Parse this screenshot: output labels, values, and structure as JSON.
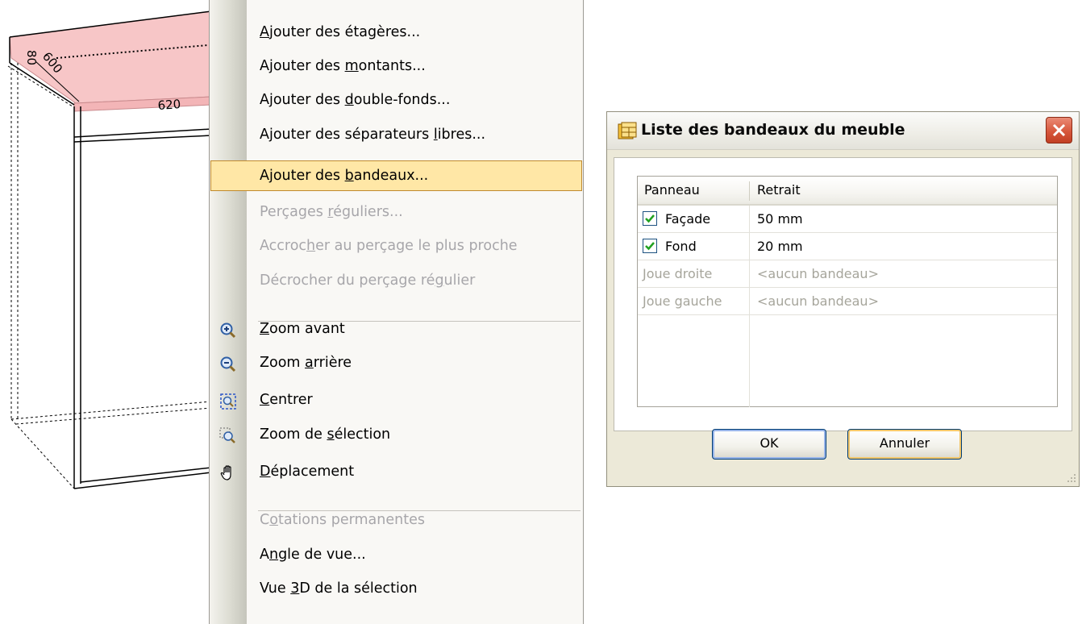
{
  "cabinet": {
    "dim_height": "80",
    "dim_depth": "600",
    "dim_width": "620",
    "highlight_color": "#f7c6c7"
  },
  "context_menu": {
    "items": [
      {
        "label": "Ajouter des étagères...",
        "pre": "",
        "u": "A",
        "post": "jouter des étagères...",
        "disabled": false,
        "highlighted": false,
        "icon": ""
      },
      {
        "label": "Ajouter des montants...",
        "pre": "Ajouter des ",
        "u": "m",
        "post": "ontants...",
        "disabled": false,
        "highlighted": false,
        "icon": ""
      },
      {
        "label": "Ajouter des double-fonds...",
        "pre": "Ajouter des ",
        "u": "d",
        "post": "ouble-fonds...",
        "disabled": false,
        "highlighted": false,
        "icon": ""
      },
      {
        "label": "Ajouter des séparateurs libres...",
        "pre": "Ajouter des séparateurs ",
        "u": "l",
        "post": "ibres...",
        "disabled": false,
        "highlighted": false,
        "icon": ""
      },
      {
        "label": "Ajouter des bandeaux...",
        "pre": "Ajouter des ",
        "u": "b",
        "post": "andeaux...",
        "disabled": false,
        "highlighted": true,
        "icon": ""
      },
      {
        "label": "Perçages réguliers...",
        "pre": "Perçages ",
        "u": "r",
        "post": "éguliers...",
        "disabled": true,
        "highlighted": false,
        "icon": ""
      },
      {
        "label": "Accrocher au perçage le plus proche",
        "pre": "Accroc",
        "u": "h",
        "post": "er au perçage le plus proche",
        "disabled": true,
        "highlighted": false,
        "icon": ""
      },
      {
        "label": "Décrocher du perçage régulier",
        "pre": "Décrocher du perçage ré",
        "u": "g",
        "post": "ulier",
        "disabled": true,
        "highlighted": false,
        "icon": ""
      },
      {
        "label": "Zoom avant",
        "pre": "",
        "u": "Z",
        "post": "oom avant",
        "disabled": false,
        "highlighted": false,
        "icon": "zoom-in-icon"
      },
      {
        "label": "Zoom arrière",
        "pre": "Zoom ",
        "u": "a",
        "post": "rrière",
        "disabled": false,
        "highlighted": false,
        "icon": "zoom-out-icon"
      },
      {
        "label": "Centrer",
        "pre": "",
        "u": "C",
        "post": "entrer",
        "disabled": false,
        "highlighted": false,
        "icon": "center-view-icon"
      },
      {
        "label": "Zoom de sélection",
        "pre": "Zoom de ",
        "u": "s",
        "post": "élection",
        "disabled": false,
        "highlighted": false,
        "icon": "zoom-selection-icon"
      },
      {
        "label": "Déplacement",
        "pre": "",
        "u": "D",
        "post": "éplacement",
        "disabled": false,
        "highlighted": false,
        "icon": "pan-hand-icon"
      },
      {
        "label": "Cotations permanentes",
        "pre": "C",
        "u": "o",
        "post": "tations permanentes",
        "disabled": true,
        "highlighted": false,
        "icon": ""
      },
      {
        "label": "Angle de vue...",
        "pre": "A",
        "u": "n",
        "post": "gle de vue...",
        "disabled": false,
        "highlighted": false,
        "icon": ""
      },
      {
        "label": "Vue 3D de la sélection",
        "pre": "Vue ",
        "u": "3",
        "post": "D de la sélection",
        "disabled": false,
        "highlighted": false,
        "icon": ""
      }
    ],
    "highlight_color": "#ffe7a6",
    "disabled_color": "#a7a6aa"
  },
  "dialog": {
    "title": "Liste des bandeaux du meuble",
    "table": {
      "columns": [
        "Panneau",
        "Retrait"
      ],
      "rows": [
        {
          "panneau": "Façade",
          "retrait": "50 mm",
          "checked": true,
          "disabled": false
        },
        {
          "panneau": "Fond",
          "retrait": "20 mm",
          "checked": true,
          "disabled": false
        },
        {
          "panneau": "Joue droite",
          "retrait": "<aucun bandeau>",
          "checked": false,
          "disabled": true
        },
        {
          "panneau": "Joue gauche",
          "retrait": "<aucun bandeau>",
          "checked": false,
          "disabled": true
        }
      ]
    },
    "ok_label": "OK",
    "cancel_label": "Annuler",
    "close_color": "#d7573c"
  }
}
